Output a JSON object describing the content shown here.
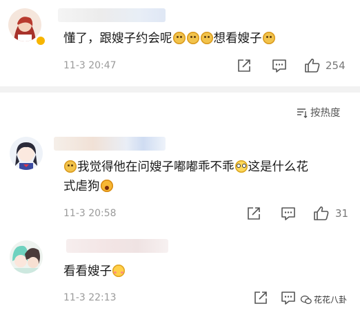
{
  "comments": [
    {
      "avatar_icon": "avatar-icon",
      "text_parts": [
        "懂了，跟嫂子约会呢",
        "想看嫂子"
      ],
      "time": "11-3 20:47",
      "likes": "254"
    },
    {
      "avatar_icon": "avatar-icon",
      "line1_parts": [
        "我觉得他在问嫂子嘟嘟乖不乖",
        "这是什么花"
      ],
      "line2_parts": [
        "式虐狗"
      ],
      "time": "11-3 20:58",
      "likes": "31"
    },
    {
      "avatar_icon": "avatar-icon",
      "text_parts": [
        "看看嫂子"
      ],
      "time": "11-3 22:13",
      "likes": ""
    }
  ],
  "sort": {
    "label": "按热度",
    "icon": "sort-icon"
  },
  "watermark": {
    "text": "花花八卦"
  },
  "colors": {
    "divider": "#f2f2f2",
    "time": "#9a9a9a",
    "text": "#1a1a1a"
  }
}
